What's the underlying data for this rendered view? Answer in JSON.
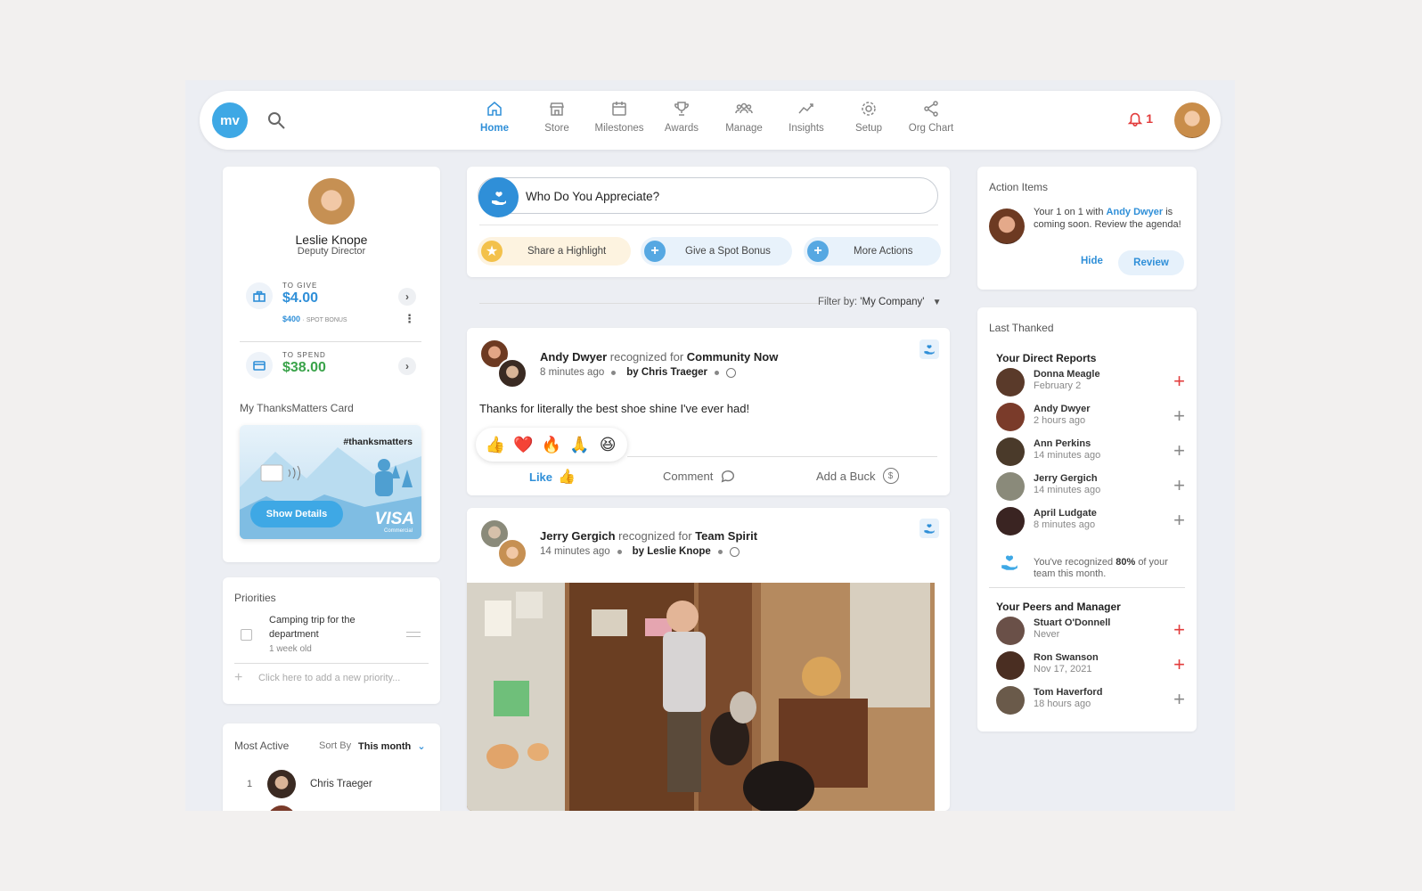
{
  "nav": {
    "logo_text": "mv",
    "items": [
      {
        "label": "Home",
        "icon": "home-icon"
      },
      {
        "label": "Store",
        "icon": "store-icon"
      },
      {
        "label": "Milestones",
        "icon": "calendar-icon"
      },
      {
        "label": "Awards",
        "icon": "trophy-icon"
      },
      {
        "label": "Manage",
        "icon": "people-icon"
      },
      {
        "label": "Insights",
        "icon": "chart-icon"
      },
      {
        "label": "Setup",
        "icon": "gear-icon"
      },
      {
        "label": "Org Chart",
        "icon": "share-icon"
      }
    ],
    "active": "Home",
    "notifications": "1"
  },
  "profile": {
    "name": "Leslie Knope",
    "title": "Deputy Director",
    "to_give_label": "TO GIVE",
    "to_give_amount": "$4.00",
    "spot_bonus_amount": "$400",
    "spot_bonus_label": "· SPOT BONUS",
    "to_spend_label": "TO SPEND",
    "to_spend_amount": "$38.00",
    "card_section_label": "My ThanksMatters Card",
    "card_hashtag": "#thanksmatters",
    "show_details": "Show Details",
    "card_brand": "VISA",
    "card_brand_sub": "Commercial"
  },
  "priorities": {
    "title": "Priorities",
    "items": [
      {
        "text_line1": "Camping trip for the",
        "text_line2": "department",
        "age": "1 week old"
      }
    ],
    "add_placeholder": "Click here to add a new priority..."
  },
  "most_active": {
    "title": "Most Active",
    "sort_label": "Sort By",
    "sort_value": "This month",
    "rows": [
      {
        "rank": "1",
        "name": "Chris Traeger"
      }
    ]
  },
  "compose": {
    "prompt": "Who Do You Appreciate?",
    "actions": [
      "Share a Highlight",
      "Give a Spot Bonus",
      "More Actions"
    ]
  },
  "feed": {
    "filter_label": "Filter by:",
    "filter_value": "'My Company'",
    "posts": [
      {
        "recipient": "Andy Dwyer",
        "verb": "recognized for",
        "award": "Community Now",
        "time": "8 minutes ago",
        "by": "by Chris Traeger",
        "message": "Thanks for literally the best shoe shine I've ever had!",
        "actions": [
          "Like",
          "Comment",
          "Add a Buck"
        ]
      },
      {
        "recipient": "Jerry Gergich",
        "verb": "recognized for",
        "award": "Team Spirit",
        "time": "14 minutes ago",
        "by": "by Leslie Knope"
      }
    ],
    "reactions": [
      "👍",
      "❤️",
      "🔥",
      "🙏",
      "😆"
    ]
  },
  "action_items": {
    "title": "Action Items",
    "text_before": "Your 1 on 1 with",
    "link": "Andy Dwyer",
    "text_after": "is coming soon. Review the agenda!",
    "hide": "Hide",
    "review": "Review"
  },
  "last_thanked": {
    "title": "Last Thanked",
    "direct_reports_title": "Your Direct Reports",
    "direct_reports": [
      {
        "name": "Donna Meagle",
        "when": "February 2",
        "color": "#5a3a2a",
        "alert": true
      },
      {
        "name": "Andy Dwyer",
        "when": "2 hours ago",
        "color": "#7a3b2a",
        "alert": false
      },
      {
        "name": "Ann Perkins",
        "when": "14 minutes ago",
        "color": "#4a3a2a",
        "alert": false
      },
      {
        "name": "Jerry Gergich",
        "when": "14 minutes ago",
        "color": "#8a8a7a",
        "alert": false
      },
      {
        "name": "April Ludgate",
        "when": "8 minutes ago",
        "color": "#3a2422",
        "alert": false
      }
    ],
    "recognized_before": "You've recognized",
    "recognized_pct": "80%",
    "recognized_after": "of your team this month.",
    "peers_title": "Your Peers and Manager",
    "peers": [
      {
        "name": "Stuart O'Donnell",
        "when": "Never",
        "color": "#6a5048",
        "alert": true
      },
      {
        "name": "Ron Swanson",
        "when": "Nov 17, 2021",
        "color": "#4a2e22",
        "alert": true
      },
      {
        "name": "Tom Haverford",
        "when": "18 hours ago",
        "color": "#6a5a4a",
        "alert": false
      }
    ]
  },
  "colors": {
    "accent": "#2f8fd8",
    "logo": "#3ea8e5",
    "alert": "#e23c3c",
    "give": "#2f8fd8",
    "spend": "#3aa34a"
  }
}
